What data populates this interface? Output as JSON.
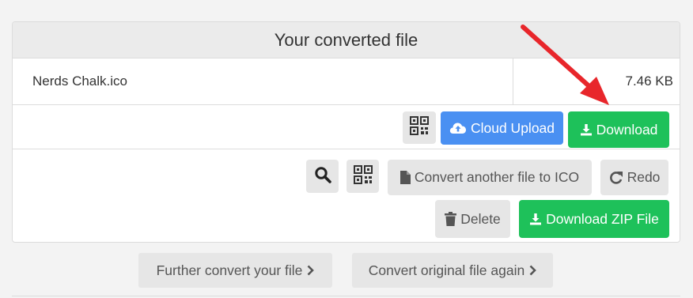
{
  "panel": {
    "title": "Your converted file"
  },
  "file": {
    "name": "Nerds Chalk.ico",
    "size": "7.46 KB"
  },
  "row1": {
    "qr_icon": "qr-code-icon",
    "cloud_upload_label": "Cloud Upload",
    "download_label": "Download"
  },
  "row2": {
    "search_icon": "search-icon",
    "qr_icon": "qr-code-icon",
    "convert_another_label": "Convert another file to ICO",
    "redo_label": "Redo",
    "delete_label": "Delete",
    "download_zip_label": "Download ZIP File"
  },
  "below": {
    "further_convert_label": "Further convert your file",
    "convert_original_label": "Convert original file again"
  },
  "colors": {
    "green": "#1ec15a",
    "blue": "#4a90f2",
    "gray_button": "#e6e6e6",
    "annotation_arrow": "#e8262b"
  }
}
